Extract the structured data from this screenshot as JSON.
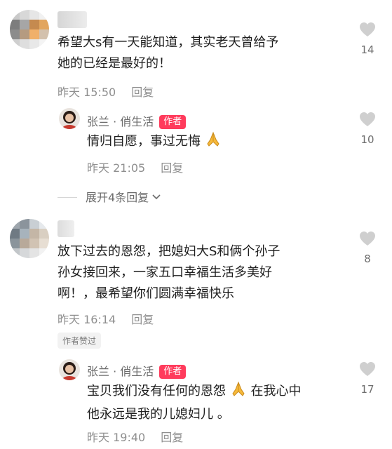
{
  "comments": [
    {
      "text_line1": "希望大s有一天能知道，其实老天曾给予",
      "text_line2": "她的已经是最好的！",
      "date": "昨天 15:50",
      "reply": "回复",
      "likes": "14",
      "author_reply": {
        "name": "张兰 · 俏生活",
        "tag": "作者",
        "text": "情归自愿，事过无悔",
        "date": "昨天 21:05",
        "reply": "回复",
        "likes": "10"
      },
      "expand": "展开4条回复"
    },
    {
      "text_line1": "放下过去的恩怨，把媳妇大S和俩个孙子",
      "text_line2": "孙女接回来，一家五口幸福生活多美好",
      "text_line3": "啊！，最希望你们圆满幸福快乐",
      "date": "昨天 16:14",
      "reply": "回复",
      "likes": "8",
      "badge": "作者赞过",
      "author_reply": {
        "name": "张兰 · 俏生活",
        "tag": "作者",
        "text_part1": "宝贝我们没有任何的恩怨",
        "text_part2": "在我心中",
        "text_line2": "他永远是我的儿媳妇儿 。",
        "date": "昨天 19:40",
        "reply": "回复",
        "likes": "17"
      }
    }
  ],
  "icons": {
    "like": "heart-outline-icon",
    "pray": "folded-hands-emoji",
    "expand": "chevron-down-icon"
  }
}
